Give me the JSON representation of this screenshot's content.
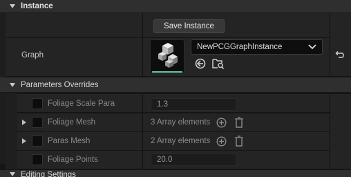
{
  "instance_section": {
    "header": "Instance",
    "save_button_label": "Save Instance",
    "graph_label": "Graph",
    "graph_value": "NewPCGGraphInstance"
  },
  "parameters_section": {
    "header": "Parameters Overrides",
    "rows": [
      {
        "label": "Foliage Scale Para",
        "value": "1.3"
      },
      {
        "label": "Foliage Mesh",
        "value": "3 Array elements"
      },
      {
        "label": "Paras Mesh",
        "value": "2 Array elements"
      },
      {
        "label": "Foliage Points",
        "value": "20.0"
      }
    ]
  },
  "next_section": {
    "header": "Editing Settings"
  },
  "colors": {
    "accent": "#5fc5a6",
    "panel": "#242424",
    "header": "#2f2f2f"
  }
}
